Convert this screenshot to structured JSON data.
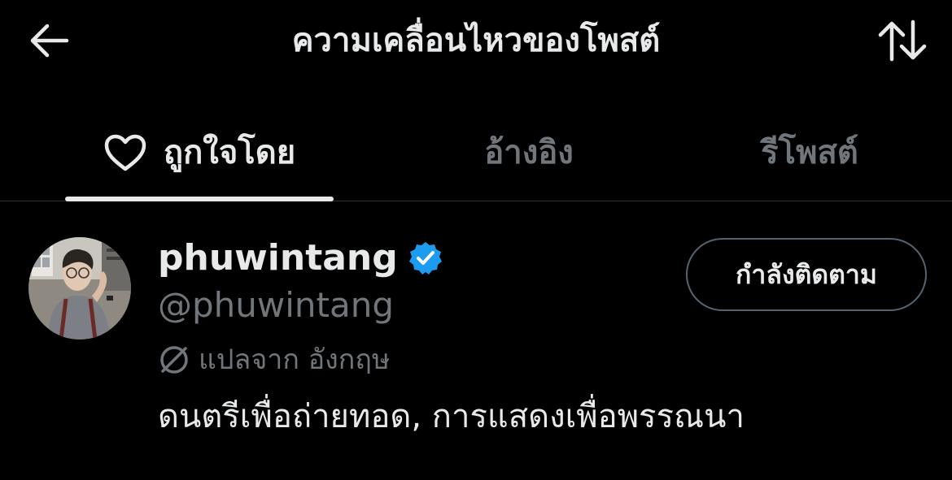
{
  "header": {
    "title": "ความเคลื่อนไหวของโพสต์",
    "back_icon": "arrow-left-icon",
    "sort_icon": "sort-arrows-icon"
  },
  "tabs": [
    {
      "label": "ถูกใจโดย",
      "icon": "heart-icon",
      "active": true
    },
    {
      "label": "อ้างอิง",
      "active": false
    },
    {
      "label": "รีโพสต์",
      "active": false
    }
  ],
  "user": {
    "display_name": "phuwintang",
    "verified": true,
    "handle": "@phuwintang",
    "follow_button_label": "กำลังติดตาม",
    "translate_label": "แปลจาก อังกฤษ",
    "bio": "ดนตรีเพื่อถ่ายทอด, การแสดงเพื่อพรรณนา"
  },
  "colors": {
    "background": "#000000",
    "primary_text": "#e7e9ea",
    "secondary_text": "#71767b",
    "verified_blue": "#1d9bf0",
    "divider": "#2f3336"
  }
}
